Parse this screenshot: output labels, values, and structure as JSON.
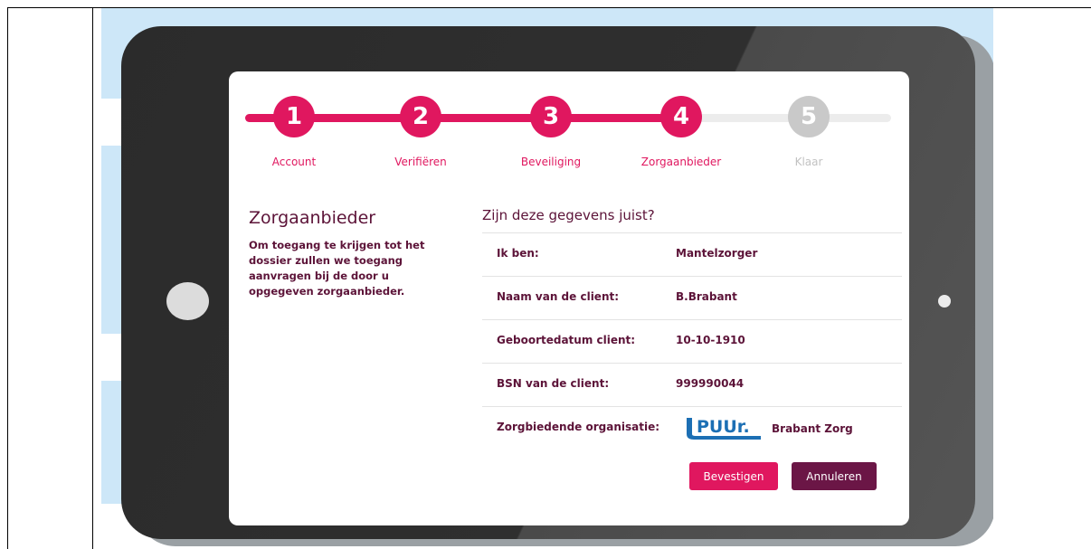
{
  "stepper": {
    "steps": [
      {
        "number": "1",
        "label": "Account",
        "state": "done"
      },
      {
        "number": "2",
        "label": "Verifiëren",
        "state": "done"
      },
      {
        "number": "3",
        "label": "Beveiliging",
        "state": "done"
      },
      {
        "number": "4",
        "label": "Zorgaanbieder",
        "state": "active"
      },
      {
        "number": "5",
        "label": "Klaar",
        "state": "todo"
      }
    ]
  },
  "left": {
    "title": "Zorgaanbieder",
    "text": "Om toegang te krijgen tot het dossier zullen we toegang aanvragen bij de door u opgegeven zorgaanbieder."
  },
  "confirm": {
    "question": "Zijn deze gegevens juist?",
    "rows": [
      {
        "label": "Ik ben:",
        "value": "Mantelzorger"
      },
      {
        "label": "Naam van de client:",
        "value": "B.Brabant"
      },
      {
        "label": "Geboortedatum client:",
        "value": "10-10-1910"
      },
      {
        "label": "BSN van de client:",
        "value": "999990044"
      },
      {
        "label": "Zorgbiedende organisatie:",
        "logo_text": "PUUr.",
        "value": "Brabant Zorg"
      }
    ]
  },
  "buttons": {
    "confirm_label": "Bevestigen",
    "cancel_label": "Annuleren"
  },
  "colors": {
    "accent": "#e0175f",
    "accent_dark": "#6b1646",
    "text": "#5c1338",
    "inactive": "#c9c9c9",
    "logo_blue": "#1c6fb4"
  }
}
